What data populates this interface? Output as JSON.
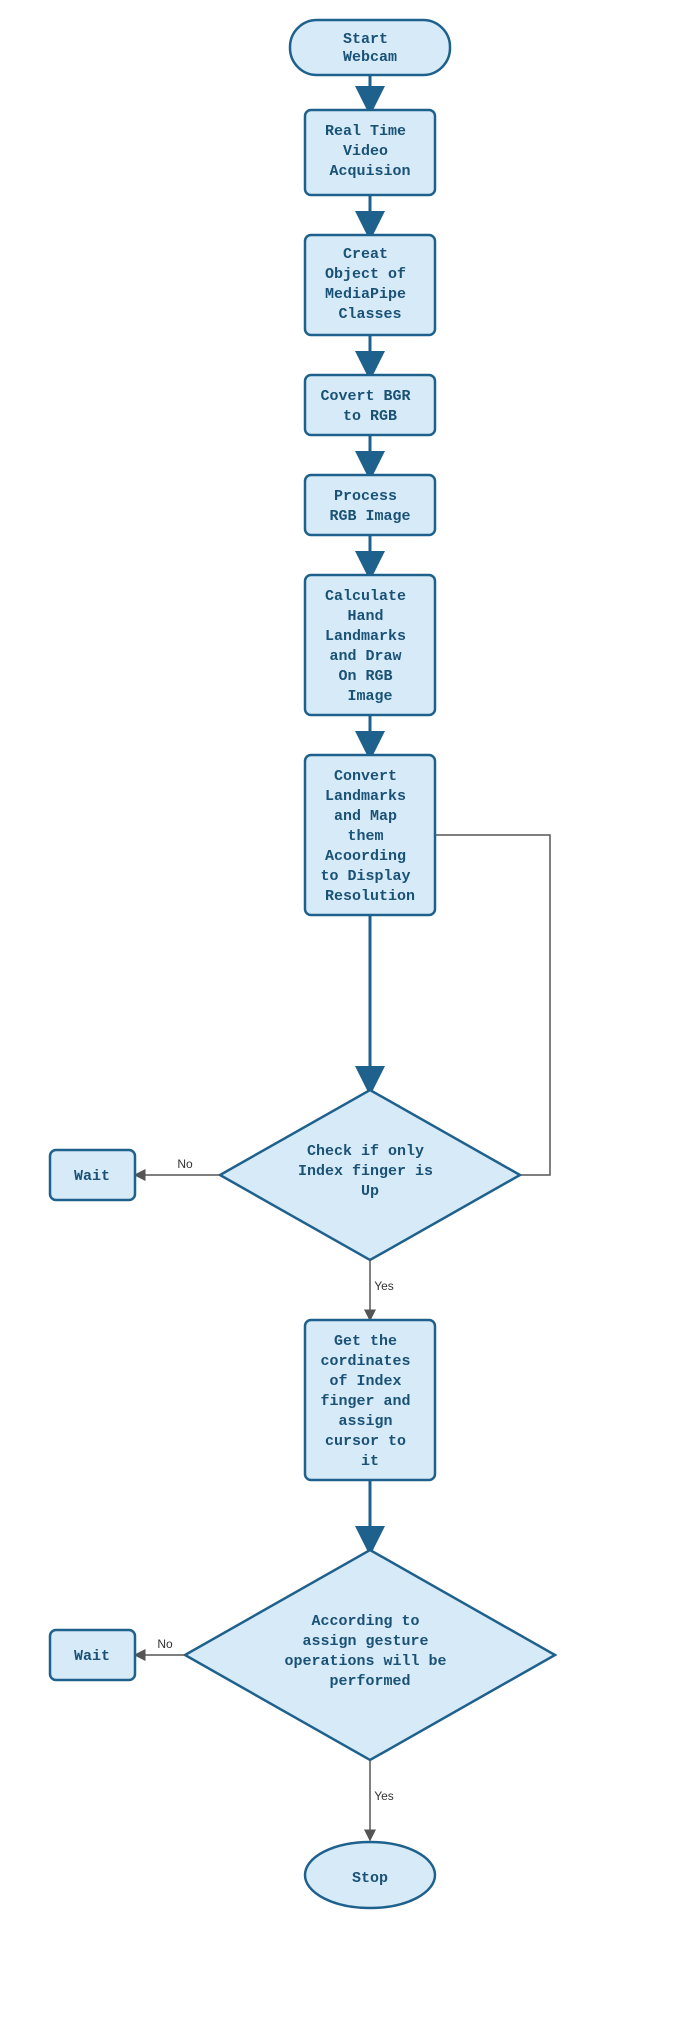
{
  "flowchart": {
    "nodes": {
      "start": "Start\nWebcam",
      "acq": "Real Time\nVideo\nAcquision",
      "obj": "Creat\nObject of\nMediaPipe\nClasses",
      "bgr": "Covert BGR\nto RGB",
      "proc": "Process\nRGB Image",
      "calc": "Calculate\nHand\nLandmarks\nand Draw\nOn RGB\nImage",
      "conv": "Convert\nLandmarks\nand Map\nthem\nAcoording\nto Display\nResolution",
      "dec1": "Check if only\nIndex finger is\nUp",
      "wait1": "Wait",
      "get": "Get the\ncordinates\nof Index\nfinger and\nassign\ncursor to\nit",
      "dec2": "According to\nassign gesture\noperations will be\nperformed",
      "wait2": "Wait",
      "stop": "Stop"
    },
    "edges": {
      "no": "No",
      "yes": "Yes"
    }
  }
}
